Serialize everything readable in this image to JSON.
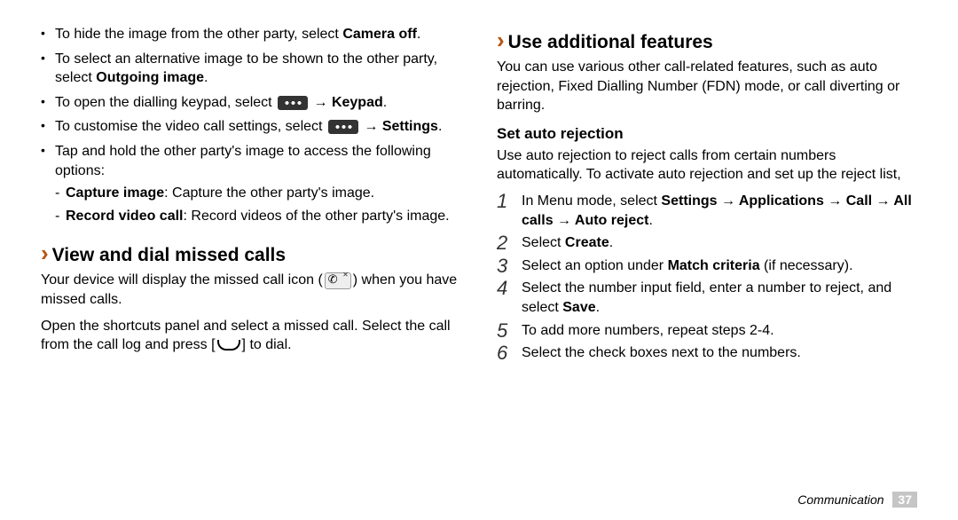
{
  "left": {
    "bullets": [
      {
        "pre": "To hide the image from the other party, select ",
        "bold": "Camera off",
        "post": "."
      },
      {
        "pre": "To select an alternative image to be shown to the other party, select ",
        "bold": "Outgoing image",
        "post": "."
      },
      {
        "pre": "To open the dialling keypad, select ",
        "mid": " → ",
        "bold": "Keypad",
        "post": "."
      },
      {
        "pre": "To customise the video call settings, select ",
        "mid": " → ",
        "bold": "Settings",
        "post": "."
      },
      {
        "pre": "Tap and hold the other party's image to access the following options:",
        "sub": [
          {
            "bold": "Capture image",
            "post": ": Capture the other party's image."
          },
          {
            "bold": "Record video call",
            "post": ": Record videos of the other party's image."
          }
        ]
      }
    ],
    "section": {
      "title": "View and dial missed calls",
      "p1a": "Your device will display the missed call icon (",
      "p1b": ") when you have missed calls.",
      "p2a": "Open the shortcuts panel and select a missed call. Select the call from the call log and press [",
      "p2b": "] to dial."
    }
  },
  "right": {
    "title": "Use additional features",
    "intro": "You can use various other call-related features, such as auto rejection, Fixed Dialling Number (FDN) mode, or call diverting or barring.",
    "sub": {
      "title": "Set auto rejection",
      "intro": "Use auto rejection to reject calls from certain numbers automatically. To activate auto rejection and set up the reject list,"
    },
    "steps": [
      {
        "n": "1",
        "pre": "In Menu mode, select ",
        "bold": "Settings → Applications → Call → All calls → Auto reject",
        "post": "."
      },
      {
        "n": "2",
        "pre": "Select ",
        "bold": "Create",
        "post": "."
      },
      {
        "n": "3",
        "pre": "Select an option under ",
        "bold": "Match criteria",
        "post": " (if necessary)."
      },
      {
        "n": "4",
        "pre": "Select the number input field, enter a number to reject, and select ",
        "bold": "Save",
        "post": "."
      },
      {
        "n": "5",
        "pre": "To add more numbers, repeat steps 2-4."
      },
      {
        "n": "6",
        "pre": "Select the check boxes next to the numbers."
      }
    ]
  },
  "footer": {
    "section": "Communication",
    "page": "37"
  }
}
